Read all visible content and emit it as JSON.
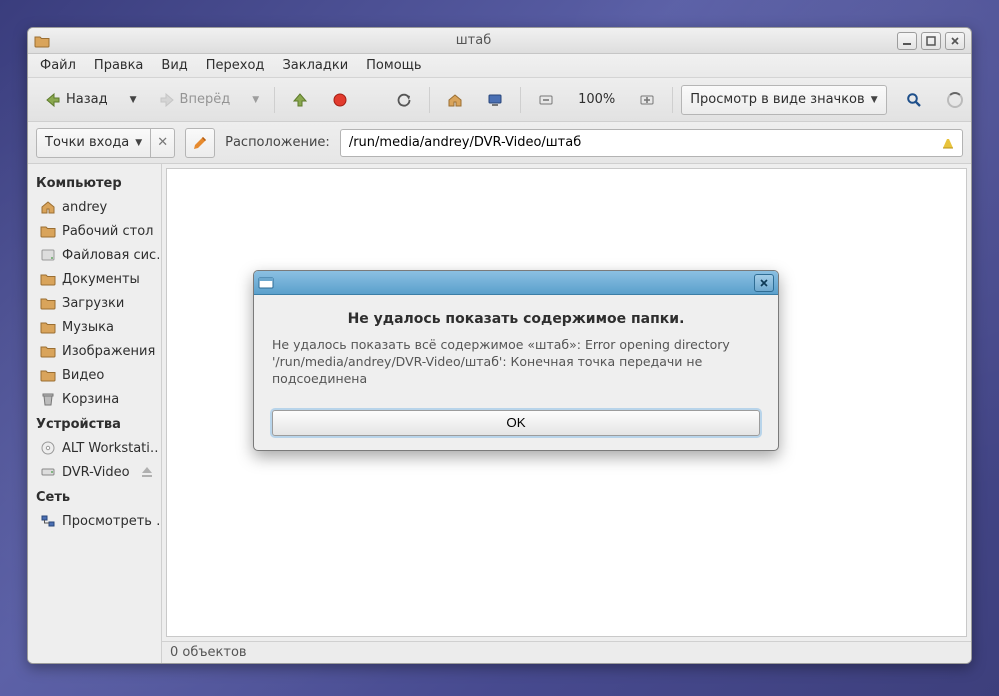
{
  "window": {
    "title": "штаб"
  },
  "menu": [
    "Файл",
    "Правка",
    "Вид",
    "Переход",
    "Закладки",
    "Помощь"
  ],
  "toolbar": {
    "back": "Назад",
    "forward": "Вперёд",
    "zoom": "100%",
    "view_mode": "Просмотр в виде значков"
  },
  "locbar": {
    "entry_points": "Точки входа",
    "location_label": "Расположение:",
    "path": "/run/media/andrey/DVR-Video/штаб"
  },
  "sidebar": {
    "group_computer": "Компьютер",
    "computer": [
      {
        "label": "andrey",
        "icon": "home"
      },
      {
        "label": "Рабочий стол",
        "icon": "folder"
      },
      {
        "label": "Файловая сис…",
        "icon": "disk"
      },
      {
        "label": "Документы",
        "icon": "folder"
      },
      {
        "label": "Загрузки",
        "icon": "folder"
      },
      {
        "label": "Музыка",
        "icon": "folder"
      },
      {
        "label": "Изображения",
        "icon": "folder"
      },
      {
        "label": "Видео",
        "icon": "folder"
      },
      {
        "label": "Корзина",
        "icon": "trash"
      }
    ],
    "group_devices": "Устройства",
    "devices": [
      {
        "label": "ALT Workstati…",
        "icon": "cd"
      },
      {
        "label": "DVR-Video",
        "icon": "drive",
        "eject": true
      }
    ],
    "group_network": "Сеть",
    "network": [
      {
        "label": "Просмотреть …",
        "icon": "network"
      }
    ]
  },
  "status": "0 объектов",
  "dialog": {
    "heading": "Не удалось показать содержимое папки.",
    "body": "Не удалось показать всё содержимое «штаб»: Error opening directory '/run/media/andrey/DVR-Video/штаб': Конечная точка передачи не подсоединена",
    "ok": "OK"
  }
}
